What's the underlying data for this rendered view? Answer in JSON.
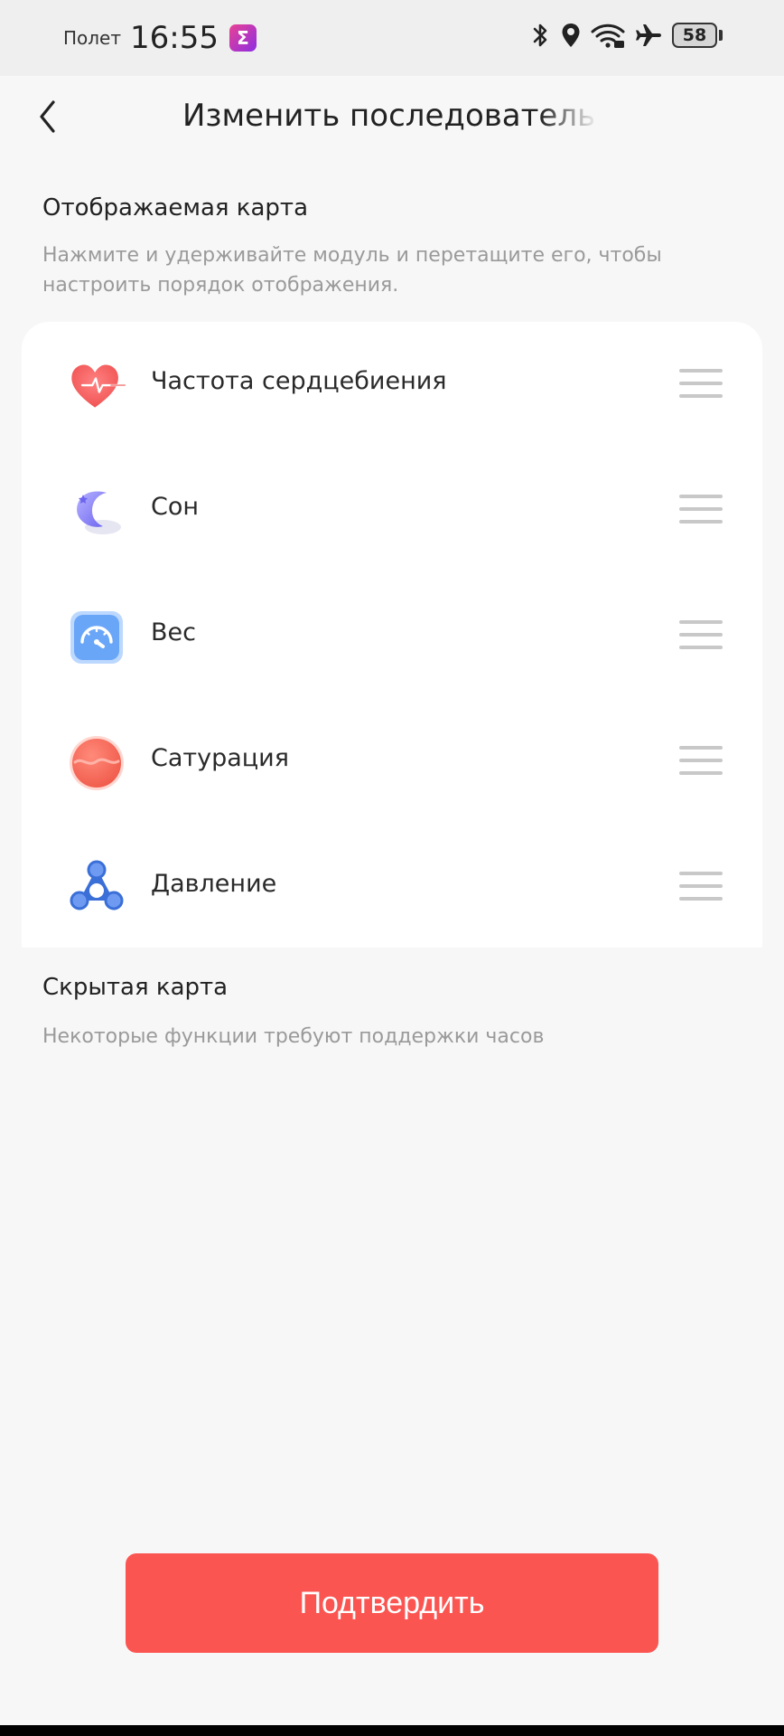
{
  "status_bar": {
    "mode": "Полет",
    "time": "16:55",
    "app_icon_letter": "Σ",
    "icons": [
      "bluetooth-icon",
      "location-icon",
      "wifi-icon",
      "airplane-icon"
    ],
    "battery": "58"
  },
  "header": {
    "back_icon": "chevron-left-icon",
    "title": "Изменить последовательно"
  },
  "displayed": {
    "title": "Отображаемая карта",
    "hint": "Нажмите и удерживайте модуль и перетащите его, чтобы настроить порядок отображения.",
    "items": [
      {
        "label": "Частота сердцебиения",
        "icon": "heart-rate-icon"
      },
      {
        "label": "Сон",
        "icon": "moon-sleep-icon"
      },
      {
        "label": "Вес",
        "icon": "scale-gauge-icon"
      },
      {
        "label": "Сатурация",
        "icon": "oxygen-saturation-icon"
      },
      {
        "label": "Давление",
        "icon": "pressure-spinner-icon"
      }
    ]
  },
  "hidden": {
    "title": "Скрытая карта",
    "hint": "Некоторые функции требуют поддержки часов"
  },
  "confirm_label": "Подтвердить",
  "colors": {
    "accent": "#fb5551",
    "background": "#f7f7f8",
    "card": "#ffffff",
    "hint_text": "#9a9a9a"
  }
}
